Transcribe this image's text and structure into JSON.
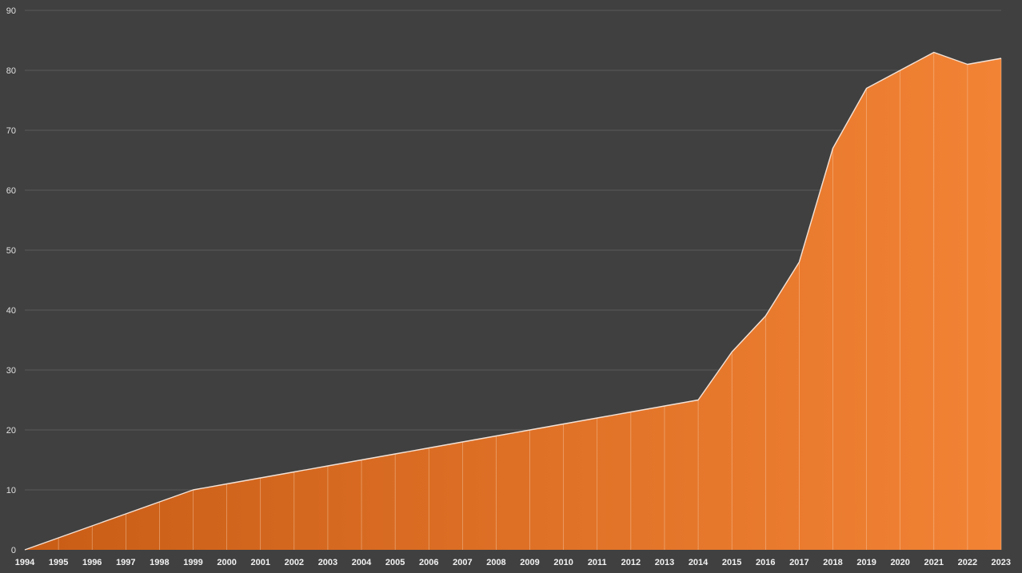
{
  "chart_data": {
    "type": "area",
    "title": "",
    "xlabel": "",
    "ylabel": "",
    "x": [
      "1994",
      "1995",
      "1996",
      "1997",
      "1998",
      "1999",
      "2000",
      "2001",
      "2002",
      "2003",
      "2004",
      "2005",
      "2006",
      "2007",
      "2008",
      "2009",
      "2010",
      "2011",
      "2012",
      "2013",
      "2014",
      "2015",
      "2016",
      "2017",
      "2018",
      "2019",
      "2020",
      "2021",
      "2022",
      "2023"
    ],
    "series": [
      {
        "values": [
          0,
          2,
          4,
          6,
          8,
          10,
          11,
          12,
          13,
          14,
          15,
          16,
          17,
          18,
          19,
          20,
          21,
          22,
          23,
          24,
          25,
          33,
          39,
          48,
          67,
          77,
          80,
          83,
          81,
          82
        ]
      }
    ],
    "ylim": [
      0,
      90
    ],
    "yticks": [
      "0",
      "10",
      "20",
      "30",
      "40",
      "50",
      "60",
      "70",
      "80",
      "90"
    ],
    "grid": true,
    "legend": "none",
    "colors": {
      "background": "#404040",
      "fill_start": "#c95d16",
      "fill_end": "#f28335",
      "line": "#f4e2d6",
      "grid": "#5a5a5a",
      "tick_text": "#e0e0e0"
    }
  }
}
